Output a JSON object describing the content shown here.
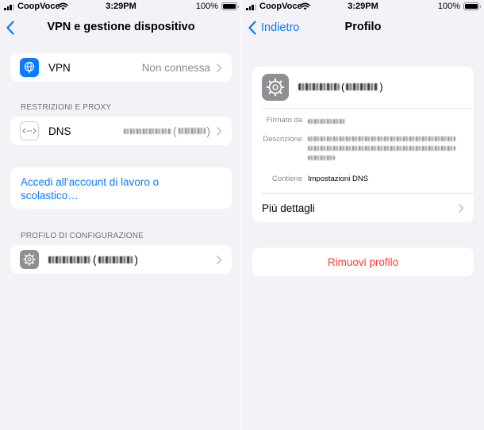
{
  "left": {
    "status": {
      "carrier": "CoopVoce",
      "time": "3:29PM",
      "battery": "100%"
    },
    "nav_title": "VPN e gestione dispositivo",
    "vpn": {
      "label": "VPN",
      "value": "Non connessa",
      "icon": "globe-icon"
    },
    "section_restrictions": "RESTRIZIONI E PROXY",
    "dns": {
      "label": "DNS",
      "icon": "dns-icon"
    },
    "work_account": {
      "line1": "Accedi all’account di lavoro o",
      "line2": "scolastico…"
    },
    "section_profile": "PROFILO DI CONFIGURAZIONE",
    "profile_row": {
      "icon": "gear-icon"
    }
  },
  "right": {
    "status": {
      "carrier": "CoopVoce",
      "time": "3:29PM",
      "battery": "100%"
    },
    "back_label": "Indietro",
    "nav_title": "Profilo",
    "signed_by_label": "Firmato da",
    "description_label": "Descrizione",
    "contains_label": "Contiene",
    "contains_value": "Impostazioni DNS",
    "more_details": "Più dettagli",
    "remove_profile": "Rimuovi profilo"
  },
  "colors": {
    "accent": "#0a7aff",
    "destructive": "#ff3b30",
    "background": "#f2f2f7",
    "secondary_text": "#8a8a8e",
    "vpn_icon": "#0a7aff",
    "gear_icon": "#8e8e93"
  }
}
